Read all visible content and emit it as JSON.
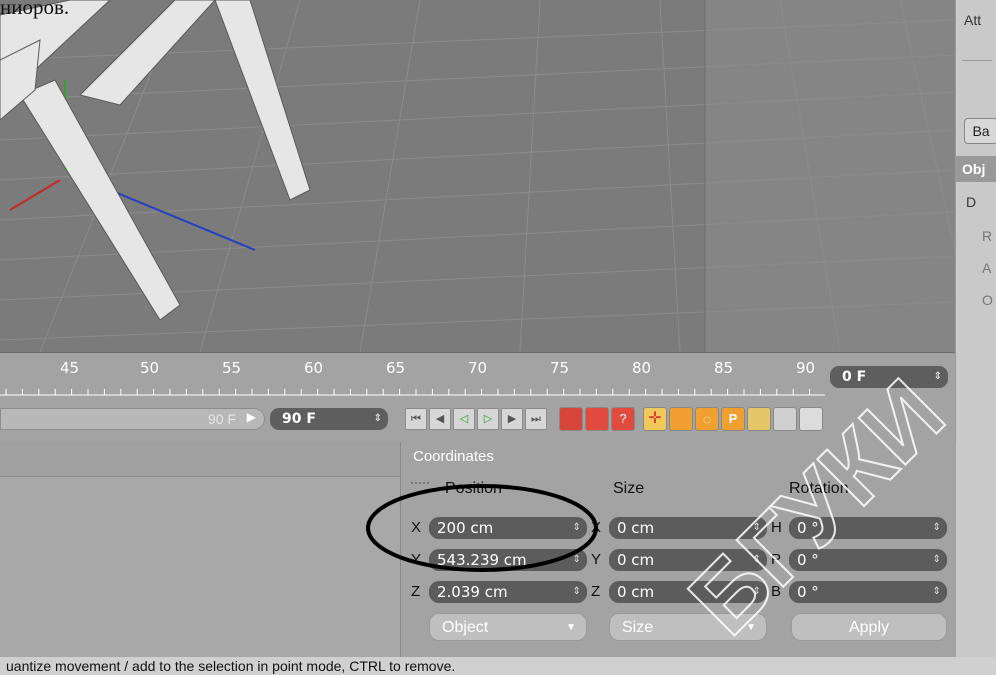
{
  "caption": "ниоров.",
  "right_panel": {
    "items": [
      "Att",
      "Ba",
      "Obj",
      "D",
      "R",
      "A",
      "O"
    ]
  },
  "timeline": {
    "ticks": [
      "45",
      "50",
      "55",
      "60",
      "65",
      "70",
      "75",
      "80",
      "85",
      "90"
    ],
    "current_frame": "0 F"
  },
  "transport": {
    "end_label": "90 F",
    "end_frame": "90 F"
  },
  "coordinates": {
    "title": "Coordinates",
    "headers": {
      "position": "Position",
      "size": "Size",
      "rotation": "Rotation"
    },
    "rows": [
      {
        "pos_axis": "X",
        "pos": "200 cm",
        "size_axis": "X",
        "size": "0 cm",
        "rot_axis": "H",
        "rot": "0 °"
      },
      {
        "pos_axis": "Y",
        "pos": "543.239 cm",
        "size_axis": "Y",
        "size": "0 cm",
        "rot_axis": "P",
        "rot": "0 °"
      },
      {
        "pos_axis": "Z",
        "pos": "2.039 cm",
        "size_axis": "Z",
        "size": "0 cm",
        "rot_axis": "B",
        "rot": "0 °"
      }
    ],
    "mode_dropdown": "Object",
    "size_dropdown": "Size",
    "apply_button": "Apply"
  },
  "status": "uantize movement / add to the selection in point mode, CTRL to remove.",
  "watermark": "БГУКИ",
  "colors": {
    "viewport": "#7f7f7f",
    "panel": "#a3a3a3",
    "field": "#5c5c5c",
    "annotation": "#000000"
  }
}
